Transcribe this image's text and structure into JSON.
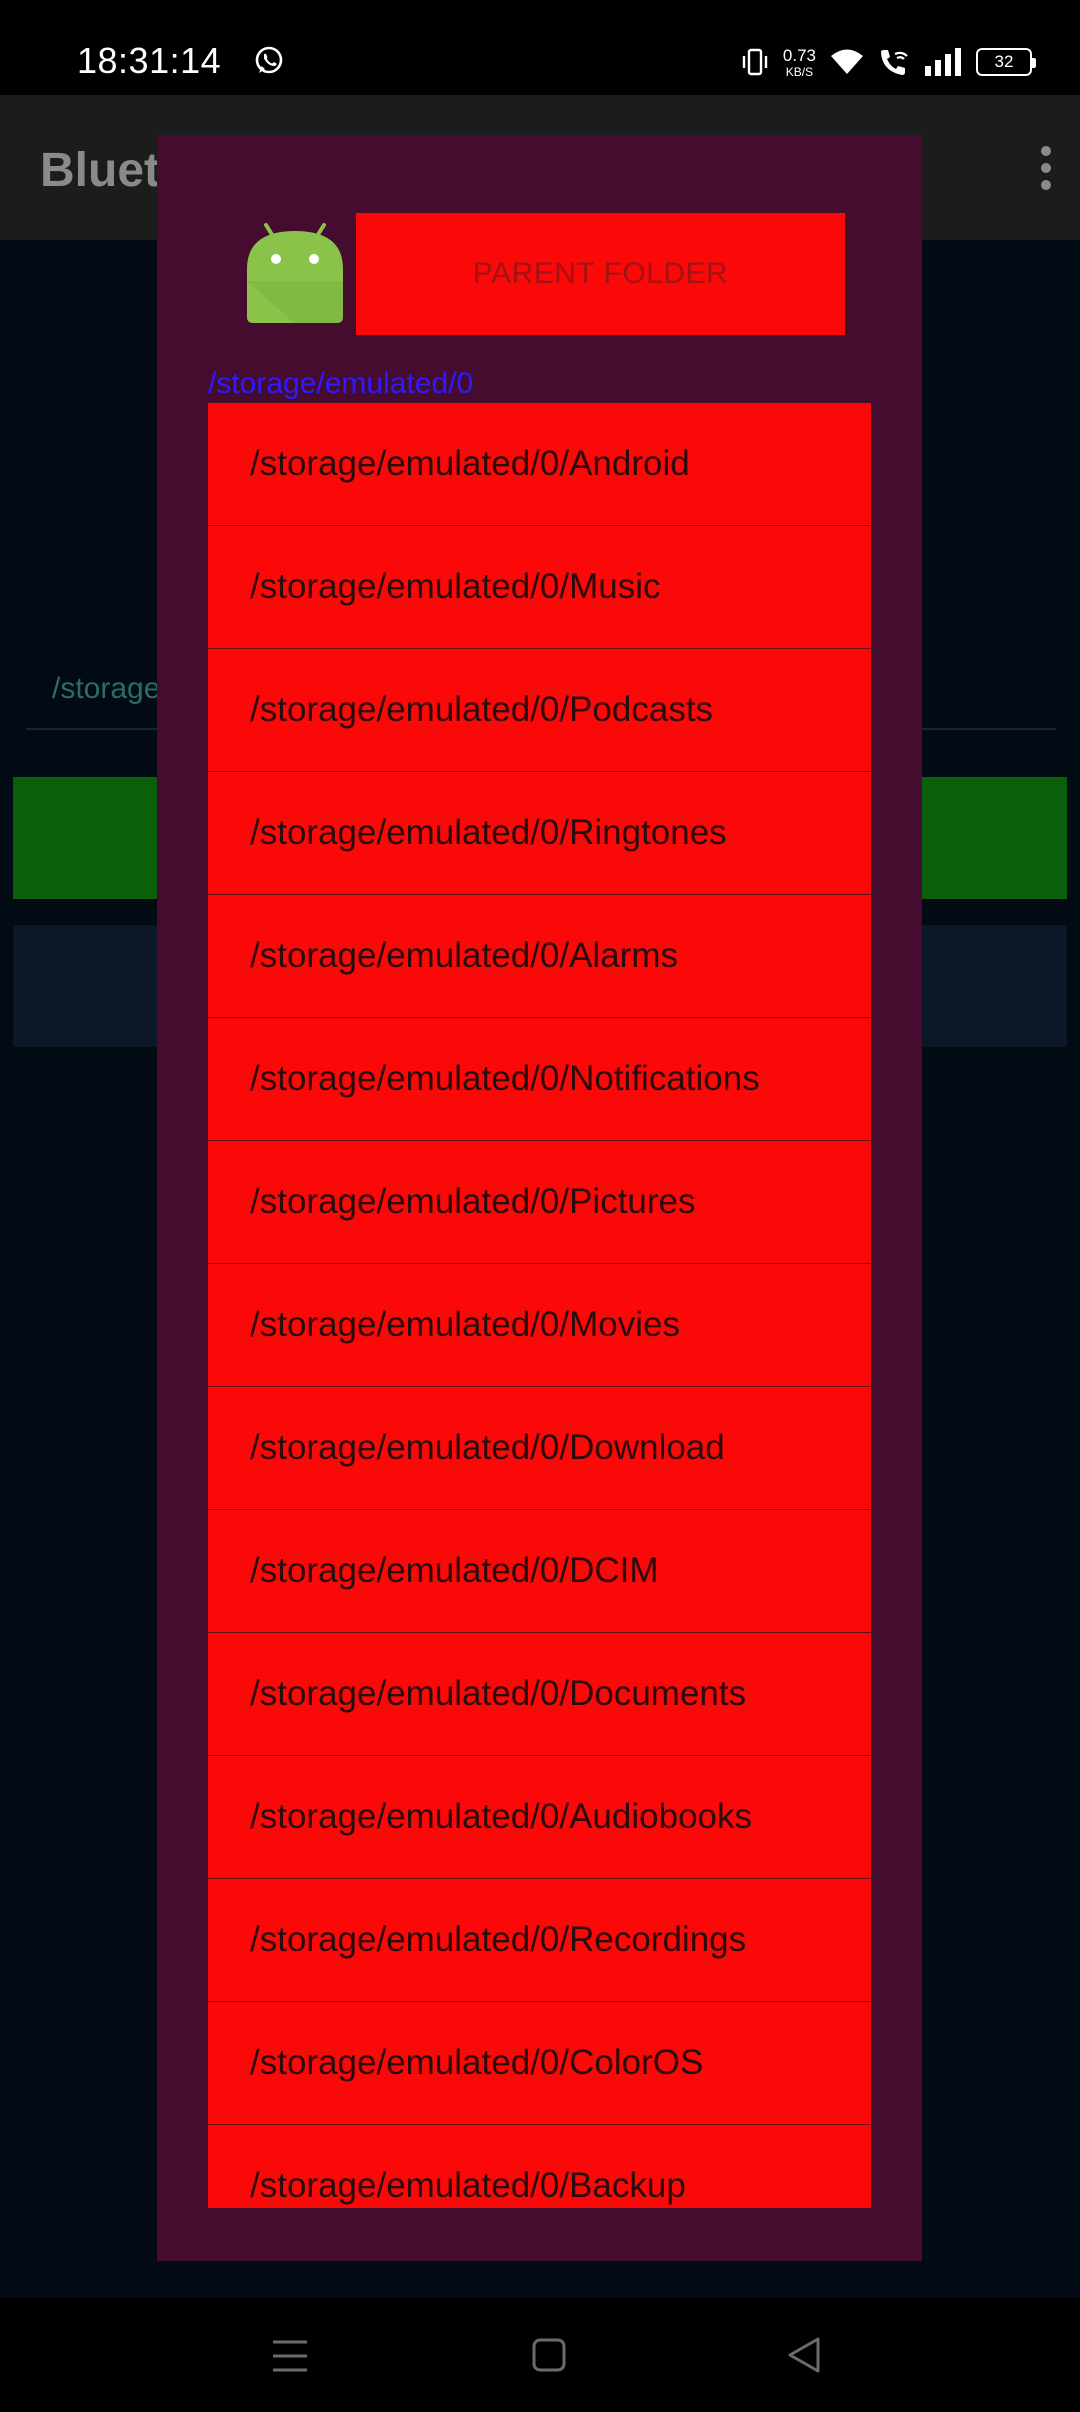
{
  "status_bar": {
    "time": "18:31:14",
    "net_speed_value": "0.73",
    "net_speed_unit": "KB/S",
    "battery_level": "32",
    "icons": [
      "whatsapp-icon",
      "vibrate-icon",
      "wifi-icon",
      "wifi-call-icon",
      "signal-icon",
      "battery-icon"
    ]
  },
  "background_app": {
    "title": "Bluet",
    "path_text": "/storage",
    "menu_icon": "overflow-menu-icon",
    "colors": {
      "app_bar": "#1c1c1c",
      "content": "#020a14",
      "green_button": "#0b5f0b"
    }
  },
  "dialog": {
    "icon": "android-robot-icon",
    "parent_button_label": "PARENT FOLDER",
    "current_path": "/storage/emulated/0",
    "items": [
      "/storage/emulated/0/Android",
      "/storage/emulated/0/Music",
      "/storage/emulated/0/Podcasts",
      "/storage/emulated/0/Ringtones",
      "/storage/emulated/0/Alarms",
      "/storage/emulated/0/Notifications",
      "/storage/emulated/0/Pictures",
      "/storage/emulated/0/Movies",
      "/storage/emulated/0/Download",
      "/storage/emulated/0/DCIM",
      "/storage/emulated/0/Documents",
      "/storage/emulated/0/Audiobooks",
      "/storage/emulated/0/Recordings",
      "/storage/emulated/0/ColorOS",
      "/storage/emulated/0/Backup"
    ],
    "colors": {
      "background": "#450c30",
      "item": "#fb0808",
      "path": "#2c1bff"
    }
  },
  "nav_bar": {
    "icons": [
      "recents-menu-icon",
      "home-square-icon",
      "back-triangle-icon"
    ]
  }
}
